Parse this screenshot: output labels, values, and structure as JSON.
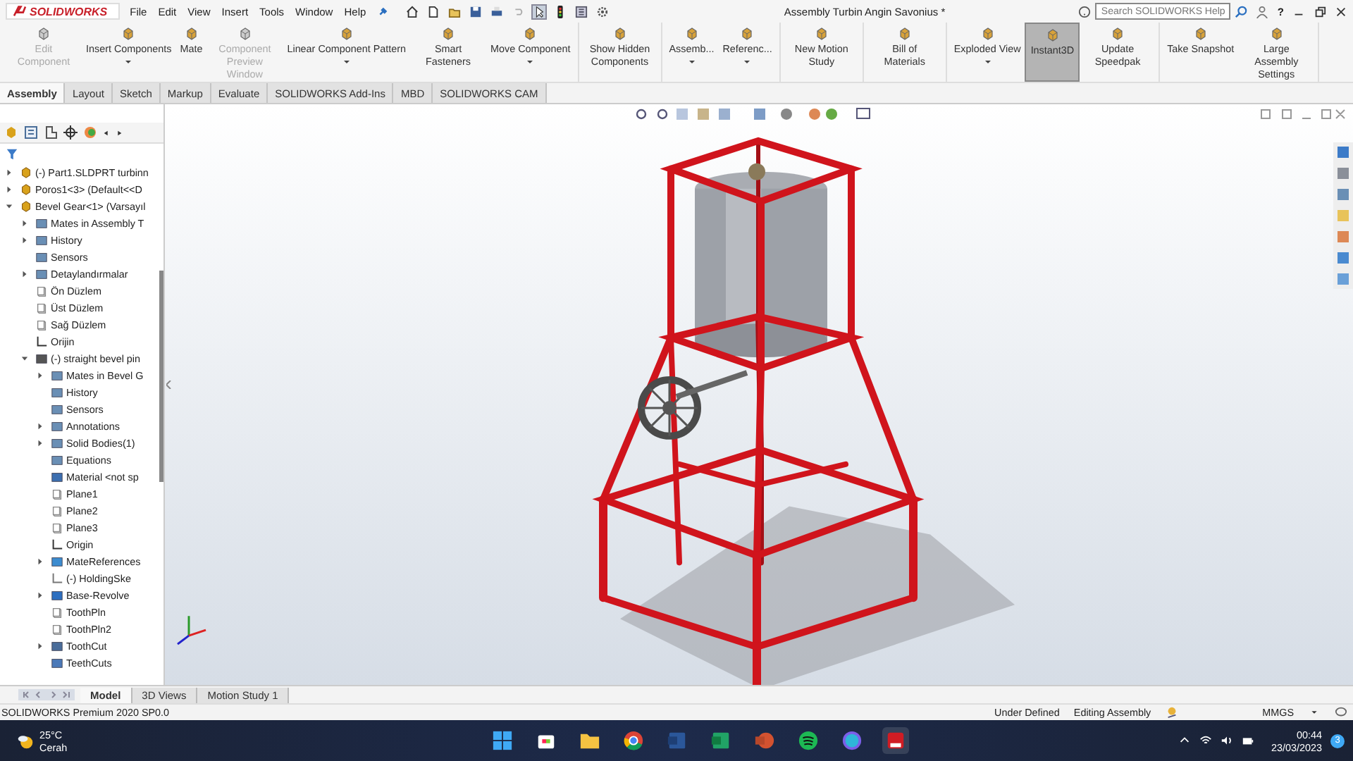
{
  "app": {
    "logo": "SOLIDWORKS",
    "menus": [
      "File",
      "Edit",
      "View",
      "Insert",
      "Tools",
      "Window",
      "Help"
    ],
    "title": "Assembly Turbin Angin Savonius *",
    "search": {
      "placeholder": "Search SOLIDWORKS Help"
    },
    "help": "?"
  },
  "ribbon": {
    "groups": [
      [
        {
          "label": "Edit Component",
          "disabled": true,
          "selected": false,
          "dropdown": false
        },
        {
          "label": "Insert Components",
          "disabled": false,
          "selected": false,
          "dropdown": true
        },
        {
          "label": "Mate",
          "disabled": false,
          "selected": false,
          "dropdown": false
        },
        {
          "label": "Component Preview Window",
          "disabled": true,
          "selected": false,
          "dropdown": false
        },
        {
          "label": "Linear Component Pattern",
          "disabled": false,
          "selected": false,
          "dropdown": true
        },
        {
          "label": "Smart Fasteners",
          "disabled": false,
          "selected": false,
          "dropdown": false
        },
        {
          "label": "Move Component",
          "disabled": false,
          "selected": false,
          "dropdown": true
        }
      ],
      [
        {
          "label": "Show Hidden Components",
          "disabled": false,
          "selected": false,
          "dropdown": false
        }
      ],
      [
        {
          "label": "Assemb...",
          "disabled": false,
          "selected": false,
          "dropdown": true
        },
        {
          "label": "Referenc...",
          "disabled": false,
          "selected": false,
          "dropdown": true
        }
      ],
      [
        {
          "label": "New Motion Study",
          "disabled": false,
          "selected": false,
          "dropdown": false
        }
      ],
      [
        {
          "label": "Bill of Materials",
          "disabled": false,
          "selected": false,
          "dropdown": false
        }
      ],
      [
        {
          "label": "Exploded View",
          "disabled": false,
          "selected": false,
          "dropdown": true
        },
        {
          "label": "Instant3D",
          "disabled": false,
          "selected": true,
          "dropdown": false
        },
        {
          "label": "Update Speedpak",
          "disabled": false,
          "selected": false,
          "dropdown": false
        }
      ],
      [
        {
          "label": "Take Snapshot",
          "disabled": false,
          "selected": false,
          "dropdown": false
        },
        {
          "label": "Large Assembly Settings",
          "disabled": false,
          "selected": false,
          "dropdown": false
        }
      ]
    ]
  },
  "tabs": [
    {
      "label": "Assembly",
      "selected": true
    },
    {
      "label": "Layout",
      "selected": false
    },
    {
      "label": "Sketch",
      "selected": false
    },
    {
      "label": "Markup",
      "selected": false
    },
    {
      "label": "Evaluate",
      "selected": false
    },
    {
      "label": "SOLIDWORKS Add-Ins",
      "selected": false
    },
    {
      "label": "MBD",
      "selected": false
    },
    {
      "label": "SOLIDWORKS CAM",
      "selected": false
    }
  ],
  "tree": [
    {
      "label": "(-) Part1.SLDPRT turbinn",
      "kind": "part",
      "expanded": false
    },
    {
      "label": "Poros1<3> (Default<<D",
      "kind": "part",
      "expanded": false
    },
    {
      "label": "Bevel Gear<1> (Varsayıl",
      "kind": "part",
      "expanded": true,
      "children": [
        {
          "label": "Mates in Assembly T",
          "kind": "folder",
          "expanded": false
        },
        {
          "label": "History",
          "kind": "folder",
          "expanded": false
        },
        {
          "label": "Sensors",
          "kind": "folder"
        },
        {
          "label": "Detaylandırmalar",
          "kind": "folder",
          "expanded": false
        },
        {
          "label": "Ön Düzlem",
          "kind": "plane"
        },
        {
          "label": "Üst Düzlem",
          "kind": "plane"
        },
        {
          "label": "Sağ Düzlem",
          "kind": "plane"
        },
        {
          "label": "Orijin",
          "kind": "origin"
        },
        {
          "label": "(-) straight bevel pin",
          "kind": "pin",
          "expanded": true,
          "children": [
            {
              "label": "Mates in Bevel G",
              "kind": "folder",
              "expanded": false
            },
            {
              "label": "History",
              "kind": "folder"
            },
            {
              "label": "Sensors",
              "kind": "folder"
            },
            {
              "label": "Annotations",
              "kind": "folder",
              "expanded": false
            },
            {
              "label": "Solid Bodies(1)",
              "kind": "folder",
              "expanded": false
            },
            {
              "label": "Equations",
              "kind": "folder"
            },
            {
              "label": "Material <not sp",
              "kind": "material"
            },
            {
              "label": "Plane1",
              "kind": "plane"
            },
            {
              "label": "Plane2",
              "kind": "plane"
            },
            {
              "label": "Plane3",
              "kind": "plane"
            },
            {
              "label": "Origin",
              "kind": "origin"
            },
            {
              "label": "MateReferences",
              "kind": "bluefolder",
              "expanded": false
            },
            {
              "label": "(-) HoldingSke",
              "kind": "sketch"
            },
            {
              "label": "Base-Revolve",
              "kind": "revolve",
              "expanded": false
            },
            {
              "label": "ToothPln",
              "kind": "plane"
            },
            {
              "label": "ToothPln2",
              "kind": "plane"
            },
            {
              "label": "ToothCut",
              "kind": "cut",
              "expanded": false
            },
            {
              "label": "TeethCuts",
              "kind": "pattern"
            }
          ]
        }
      ]
    }
  ],
  "bottom_tabs": [
    {
      "label": "Model",
      "selected": true
    },
    {
      "label": "3D Views",
      "selected": false
    },
    {
      "label": "Motion Study 1",
      "selected": false
    }
  ],
  "status_bar": {
    "product": "SOLIDWORKS Premium 2020 SP0.0",
    "state": "Under Defined",
    "mode": "Editing Assembly",
    "units": "MMGS"
  },
  "taskbar": {
    "temperature": "25°C",
    "weather": "Cerah",
    "time": "00:44",
    "date": "23/03/2023",
    "notifications": "3"
  }
}
